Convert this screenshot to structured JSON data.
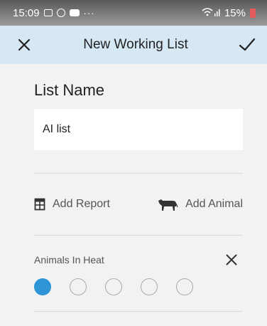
{
  "status_bar": {
    "time": "15:09",
    "dots": "···",
    "battery_percent": "15%"
  },
  "app_bar": {
    "title": "New Working List",
    "close_icon": "close-icon",
    "confirm_icon": "checkmark-icon"
  },
  "form": {
    "list_name_label": "List Name",
    "list_name_value": "AI list"
  },
  "actions": {
    "add_report": "Add Report",
    "add_animal": "Add Animal"
  },
  "report": {
    "title": "Animals In Heat",
    "pager": {
      "total": 5,
      "active_index": 0
    }
  },
  "colors": {
    "app_bar_bg": "#d5e8f4",
    "accent": "#2d95d6",
    "page_bg": "#f2f2f2"
  }
}
